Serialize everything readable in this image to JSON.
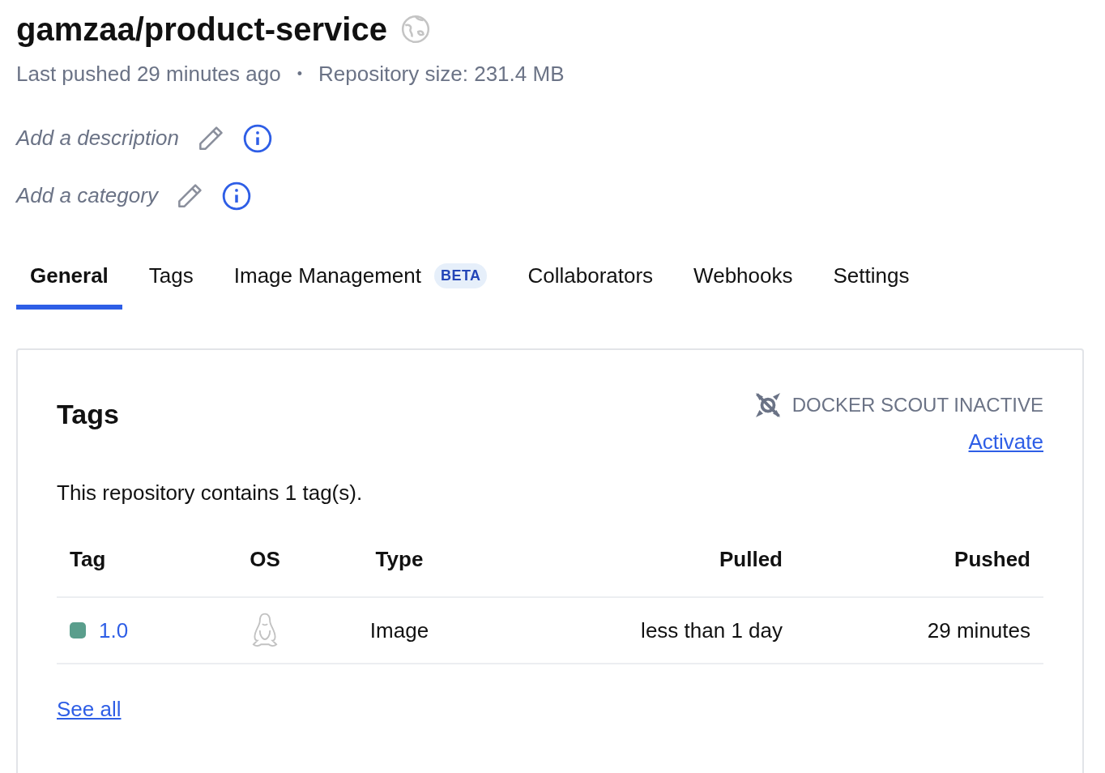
{
  "repository": {
    "title": "gamzaa/product-service",
    "last_pushed": "Last pushed 29 minutes ago",
    "separator": "•",
    "size": "Repository size: 231.4 MB"
  },
  "meta_fields": [
    {
      "label": "Add a description"
    },
    {
      "label": "Add a category"
    }
  ],
  "tabs": [
    {
      "label": "General",
      "selected": true
    },
    {
      "label": "Tags",
      "selected": false
    },
    {
      "label": "Image Management",
      "selected": false,
      "badge": "BETA"
    },
    {
      "label": "Collaborators",
      "selected": false
    },
    {
      "label": "Webhooks",
      "selected": false
    },
    {
      "label": "Settings",
      "selected": false
    }
  ],
  "tags_card": {
    "title": "Tags",
    "scout_status": "DOCKER SCOUT INACTIVE",
    "activate_link": "Activate",
    "summary": "This repository contains 1 tag(s).",
    "table": {
      "columns": [
        "Tag",
        "OS",
        "Type",
        "Pulled",
        "Pushed"
      ],
      "rows": [
        {
          "tag": "1.0",
          "color": "#5a9e8c",
          "type": "Image",
          "pulled": "less than 1 day",
          "pushed": "29 minutes"
        }
      ]
    },
    "see_all": "See all"
  }
}
